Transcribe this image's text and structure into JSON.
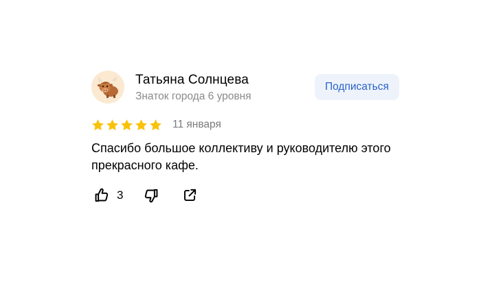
{
  "review": {
    "author": {
      "name": "Татьяна Солнцева",
      "level": "Знаток города 6 уровня",
      "avatar_icon": "bull-icon"
    },
    "subscribe_label": "Подписаться",
    "rating": {
      "value": 5,
      "max": 5,
      "star_color": "#f9c20a"
    },
    "date": "11 января",
    "text": "Спасибо большое коллективу и руководителю этого прекрасного кафе.",
    "actions": {
      "like_icon": "thumbs-up-icon",
      "like_count": "3",
      "dislike_icon": "thumbs-down-icon",
      "share_icon": "share-icon"
    },
    "colors": {
      "accent": "#2a62c9",
      "subscribe_bg": "#eef3fb",
      "muted_text": "#8a8a8a"
    }
  }
}
